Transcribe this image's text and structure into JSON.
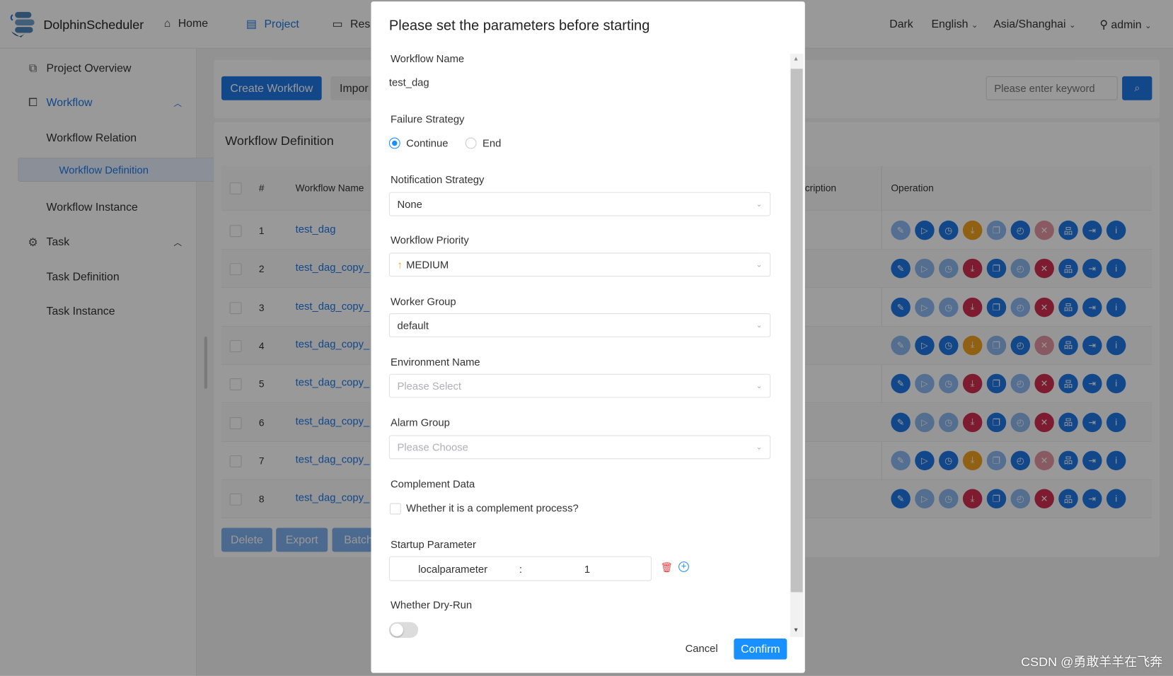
{
  "header": {
    "brand": "DolphinScheduler",
    "nav": [
      {
        "label": "Home",
        "icon": "home-icon"
      },
      {
        "label": "Project",
        "icon": "project-icon"
      },
      {
        "label": "Res",
        "icon": "folder-icon"
      }
    ],
    "theme": "Dark",
    "language": "English",
    "timezone": "Asia/Shanghai",
    "user": "admin"
  },
  "sidebar": {
    "items": [
      {
        "label": "Project Overview",
        "icon": "chart-icon",
        "type": "top"
      },
      {
        "label": "Workflow",
        "icon": "workflow-icon",
        "type": "group"
      },
      {
        "label": "Workflow Relation",
        "type": "sub"
      },
      {
        "label": "Workflow Definition",
        "type": "sub",
        "selected": true
      },
      {
        "label": "Workflow Instance",
        "type": "sub"
      },
      {
        "label": "Task",
        "icon": "gear-icon",
        "type": "top"
      },
      {
        "label": "Task Definition",
        "type": "sub"
      },
      {
        "label": "Task Instance",
        "type": "sub"
      }
    ]
  },
  "toolbar": {
    "create": "Create Workflow",
    "import": "Impor",
    "search_placeholder": "Please enter keyword"
  },
  "table": {
    "title": "Workflow Definition",
    "headers": {
      "index": "#",
      "name": "Workflow Name",
      "description": "cription",
      "operation": "Operation"
    },
    "rows": [
      {
        "index": "1",
        "name": "test_dag",
        "state": "A"
      },
      {
        "index": "2",
        "name": "test_dag_copy_",
        "state": "B"
      },
      {
        "index": "3",
        "name": "test_dag_copy_",
        "state": "B"
      },
      {
        "index": "4",
        "name": "test_dag_copy_",
        "state": "A"
      },
      {
        "index": "5",
        "name": "test_dag_copy_",
        "state": "B"
      },
      {
        "index": "6",
        "name": "test_dag_copy_",
        "state": "B"
      },
      {
        "index": "7",
        "name": "test_dag_copy_",
        "state": "A"
      },
      {
        "index": "8",
        "name": "test_dag_copy_",
        "state": "B"
      }
    ],
    "bottom_buttons": [
      "Delete",
      "Export",
      "Batch"
    ]
  },
  "colors": {
    "primary": "#1e78e6",
    "orange": "#f0a020",
    "red": "#d03050"
  },
  "modal": {
    "title": "Please set the parameters before starting",
    "workflow_name_label": "Workflow Name",
    "workflow_name": "test_dag",
    "failure_strategy_label": "Failure Strategy",
    "failure_options": [
      "Continue",
      "End"
    ],
    "notification_label": "Notification Strategy",
    "notification_value": "None",
    "priority_label": "Workflow Priority",
    "priority_value": "MEDIUM",
    "worker_group_label": "Worker Group",
    "worker_group_value": "default",
    "environment_label": "Environment Name",
    "environment_placeholder": "Please Select",
    "alarm_label": "Alarm Group",
    "alarm_placeholder": "Please Choose",
    "complement_label": "Complement Data",
    "complement_checkbox": "Whether it is a complement process?",
    "startup_label": "Startup Parameter",
    "param_key": "localparameter",
    "param_sep": ":",
    "param_value": "1",
    "dry_run_label": "Whether Dry-Run",
    "dry_run": false,
    "cancel": "Cancel",
    "confirm": "Confirm"
  },
  "watermark": "CSDN @勇敢羊羊在飞奔"
}
